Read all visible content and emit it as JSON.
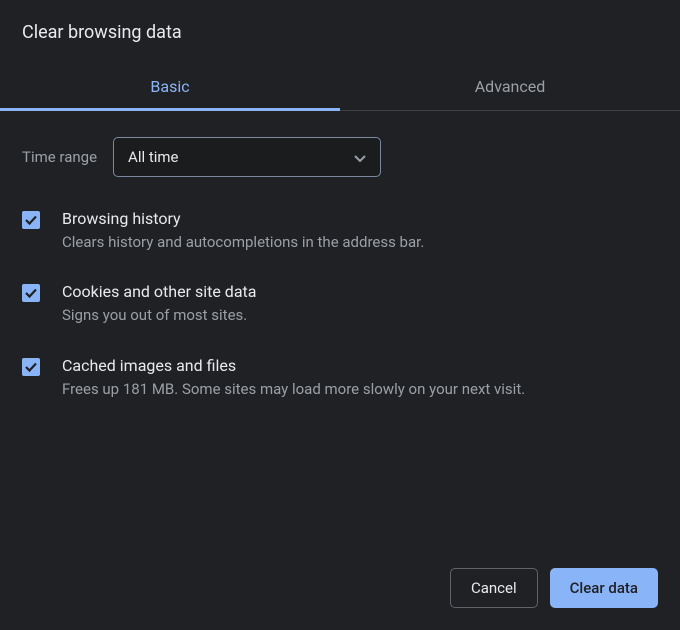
{
  "dialog": {
    "title": "Clear browsing data"
  },
  "tabs": {
    "basic": "Basic",
    "advanced": "Advanced"
  },
  "timeRange": {
    "label": "Time range",
    "value": "All time"
  },
  "options": {
    "browsingHistory": {
      "title": "Browsing history",
      "desc": "Clears history and autocompletions in the address bar."
    },
    "cookies": {
      "title": "Cookies and other site data",
      "desc": "Signs you out of most sites."
    },
    "cache": {
      "title": "Cached images and files",
      "desc": "Frees up 181 MB. Some sites may load more slowly on your next visit."
    }
  },
  "buttons": {
    "cancel": "Cancel",
    "clear": "Clear data"
  }
}
